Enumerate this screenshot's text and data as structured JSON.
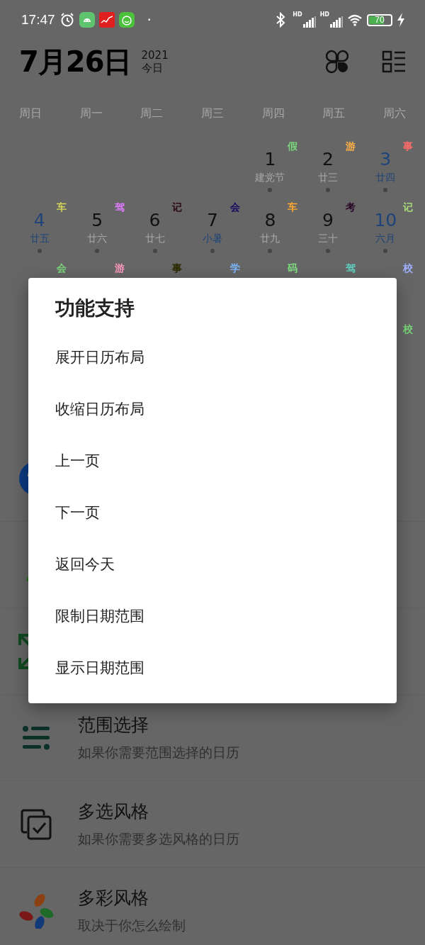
{
  "status_bar": {
    "time": "17:47",
    "notifications": [
      {
        "kind": "android"
      },
      {
        "kind": "stocks"
      },
      {
        "kind": "face"
      }
    ],
    "more": "·",
    "signals": [
      {
        "label": "HD"
      },
      {
        "label": "HD"
      }
    ],
    "battery": "70"
  },
  "header": {
    "date": "7月26日",
    "year": "2021",
    "today": "今日"
  },
  "calendar": {
    "weekdays": [
      "周日",
      "周一",
      "周二",
      "周三",
      "周四",
      "周五",
      "周六"
    ],
    "weeks": [
      [
        {
          "kind": "empty"
        },
        {
          "kind": "empty"
        },
        {
          "kind": "empty"
        },
        {
          "kind": "empty"
        },
        {
          "kind": "day",
          "day": "1",
          "lunar": "建党节",
          "weekend": false,
          "lunar_highlight": false,
          "mark": "假",
          "color": "#7ad67a"
        },
        {
          "kind": "day",
          "day": "2",
          "lunar": "廿三",
          "weekend": false,
          "lunar_highlight": false,
          "mark": "游",
          "color": "#ffb347"
        },
        {
          "kind": "day",
          "day": "3",
          "lunar": "廿四",
          "weekend": true,
          "lunar_highlight": true,
          "mark": "事",
          "color": "#ff6b6b"
        }
      ],
      [
        {
          "kind": "day",
          "day": "4",
          "lunar": "廿五",
          "weekend": true,
          "lunar_highlight": true,
          "mark": "车",
          "color": "#d4d45a"
        },
        {
          "kind": "day",
          "day": "5",
          "lunar": "廿六",
          "weekend": false,
          "lunar_highlight": false,
          "mark": "驾",
          "color": "#e07aff"
        },
        {
          "kind": "day",
          "day": "6",
          "lunar": "廿七",
          "weekend": false,
          "lunar_highlight": false,
          "mark": "记",
          "color": "#2a0a14"
        },
        {
          "kind": "day",
          "day": "7",
          "lunar": "小暑",
          "weekend": false,
          "lunar_highlight": true,
          "mark": "会",
          "color": "#1a0c60"
        },
        {
          "kind": "day",
          "day": "8",
          "lunar": "廿九",
          "weekend": false,
          "lunar_highlight": false,
          "mark": "车",
          "color": "#ffa830"
        },
        {
          "kind": "day",
          "day": "9",
          "lunar": "三十",
          "weekend": false,
          "lunar_highlight": false,
          "mark": "考",
          "color": "#2a0528"
        },
        {
          "kind": "day",
          "day": "10",
          "lunar": "六月",
          "weekend": true,
          "lunar_highlight": true,
          "mark": "记",
          "color": "#a8d878"
        }
      ],
      [
        {
          "kind": "covered",
          "mark": "会",
          "color": "#7ad67a"
        },
        {
          "kind": "covered",
          "mark": "游",
          "color": "#ff9ac0"
        },
        {
          "kind": "covered",
          "mark": "事",
          "color": "#2a2a00"
        },
        {
          "kind": "covered",
          "mark": "学",
          "color": "#7ab8ff"
        },
        {
          "kind": "covered",
          "mark": "码",
          "color": "#80e080"
        },
        {
          "kind": "covered",
          "mark": "驾",
          "color": "#60d0c0"
        },
        {
          "kind": "covered",
          "mark": "校",
          "color": "#a0b0ff"
        }
      ],
      [
        {
          "kind": "hidden"
        },
        {
          "kind": "hidden"
        },
        {
          "kind": "hidden"
        },
        {
          "kind": "hidden"
        },
        {
          "kind": "hidden"
        },
        {
          "kind": "hidden"
        },
        {
          "kind": "covered",
          "mark": "校",
          "color": "#78d878"
        }
      ]
    ]
  },
  "features": [
    {
      "kind": "circle"
    },
    {
      "kind": "figure"
    },
    {
      "kind": "expand"
    },
    {
      "kind": "range",
      "title": "范围选择",
      "subtitle": "如果你需要范围选择的日历"
    },
    {
      "kind": "multi",
      "title": "多选风格",
      "subtitle": "如果你需要多选风格的日历"
    },
    {
      "kind": "colorful",
      "title": "多彩风格",
      "subtitle": "取决于你怎么绘制"
    }
  ],
  "dialog": {
    "title": "功能支持",
    "items": [
      "展开日历布局",
      "收缩日历布局",
      "上一页",
      "下一页",
      "返回今天",
      "限制日期范围",
      "显示日期范围"
    ]
  }
}
